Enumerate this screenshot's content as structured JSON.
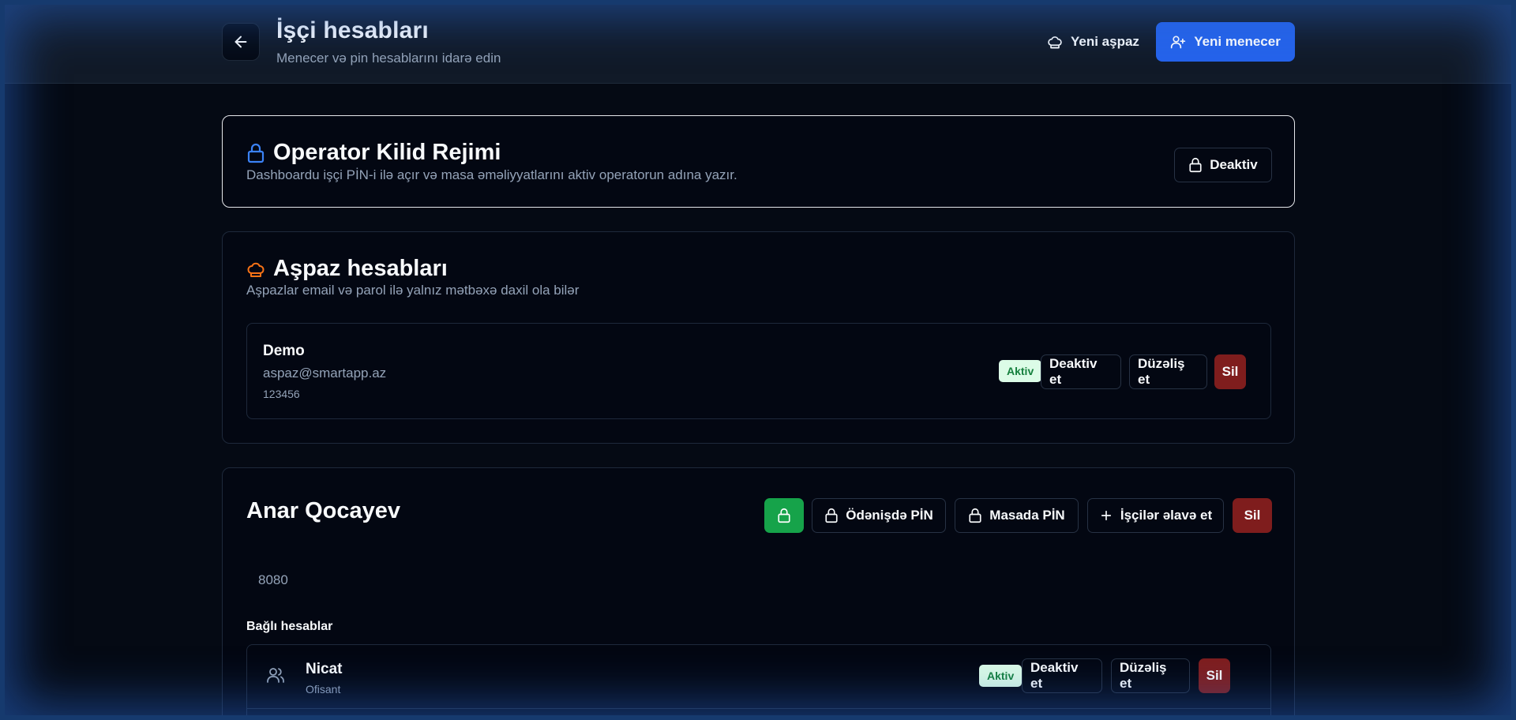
{
  "header": {
    "title": "İşçi hesabları",
    "subtitle": "Menecer və pin hesablarını idarə edin",
    "new_cook_label": "Yeni aşpaz",
    "new_manager_label": "Yeni menecer"
  },
  "operator_lock": {
    "title": "Operator Kilid Rejimi",
    "description": "Dashboardu işçi PİN-i ilə açır və masa əməliyyatlarını aktiv operatorun adına yazır.",
    "toggle_label": "Deaktiv"
  },
  "cooks": {
    "title": "Aşpaz hesabları",
    "description": "Aşpazlar email və parol ilə yalnız mətbəxə daxil ola bilər",
    "items": [
      {
        "name": "Demo",
        "email": "aspaz@smartapp.az",
        "pin": "123456",
        "status": "Aktiv",
        "deactivate_label": "Deaktiv et",
        "edit_label": "Düzəliş et",
        "delete_label": "Sil"
      }
    ]
  },
  "manager": {
    "name": "Anar Qocayev",
    "pin": "8080",
    "payment_pin_label": "Ödənişdə PİN",
    "table_pin_label": "Masada PİN",
    "add_workers_label": "İşçilər əlavə et",
    "delete_label": "Sil",
    "linked_title": "Bağlı hesablar",
    "linked": [
      {
        "name": "Nicat",
        "role": "Ofisant",
        "status": "Aktiv",
        "deactivate_label": "Deaktiv et",
        "edit_label": "Düzəliş et",
        "delete_label": "Sil"
      }
    ]
  },
  "colors": {
    "primary": "#2563eb",
    "danger": "#7f1d1d",
    "success": "#16a34a",
    "lock_icon": "#3b82f6",
    "cook_icon": "#f97316"
  },
  "icons": {
    "back": "arrow-left-icon",
    "chef_hat": "chef-hat-icon",
    "user_plus": "user-plus-icon",
    "lock": "lock-icon",
    "plus": "plus-icon",
    "users": "users-icon"
  }
}
